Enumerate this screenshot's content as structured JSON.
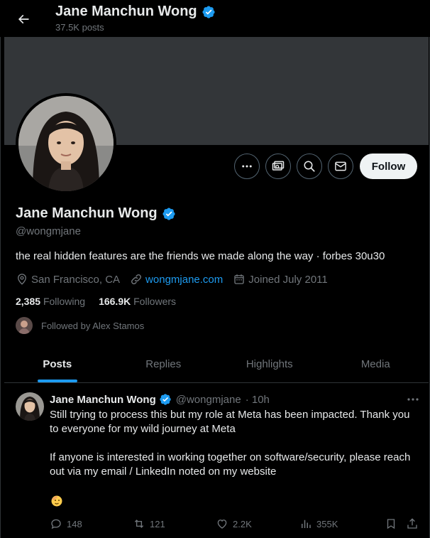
{
  "header": {
    "back_icon": "arrow-left-icon",
    "name": "Jane Manchun Wong",
    "posts_count": "37.5K posts"
  },
  "profile": {
    "name": "Jane Manchun Wong",
    "handle": "@wongmjane",
    "bio": "the real hidden features are the friends we made along the way · forbes 30u30",
    "location": "San Francisco, CA",
    "website": "wongmjane.com",
    "joined": "Joined July 2011",
    "following_count": "2,385",
    "following_label": "Following",
    "followers_count": "166.9K",
    "followers_label": "Followers",
    "followed_by": "Followed by Alex Stamos",
    "follow_button": "Follow",
    "verified_color": "#1d9bf0"
  },
  "actions": {
    "more_icon": "more-icon",
    "subscribe_icon": "money-icon",
    "search_icon": "search-icon",
    "message_icon": "mail-icon"
  },
  "tabs": [
    {
      "label": "Posts",
      "active": true
    },
    {
      "label": "Replies",
      "active": false
    },
    {
      "label": "Highlights",
      "active": false
    },
    {
      "label": "Media",
      "active": false
    }
  ],
  "post": {
    "author": "Jane Manchun Wong",
    "handle": "@wongmjane",
    "time": "· 10h",
    "paragraph1": "Still trying to process this but my role at Meta has been impacted. Thank you to everyone for my wild journey at Meta",
    "paragraph2": "If anyone is interested in working together on software/security, please reach out via my email / LinkedIn noted on my website",
    "replies": "148",
    "reposts": "121",
    "likes": "2.2K",
    "views": "355K"
  },
  "colors": {
    "background": "#000000",
    "accent": "#1d9bf0",
    "muted": "#71767b",
    "banner": "#333639"
  }
}
